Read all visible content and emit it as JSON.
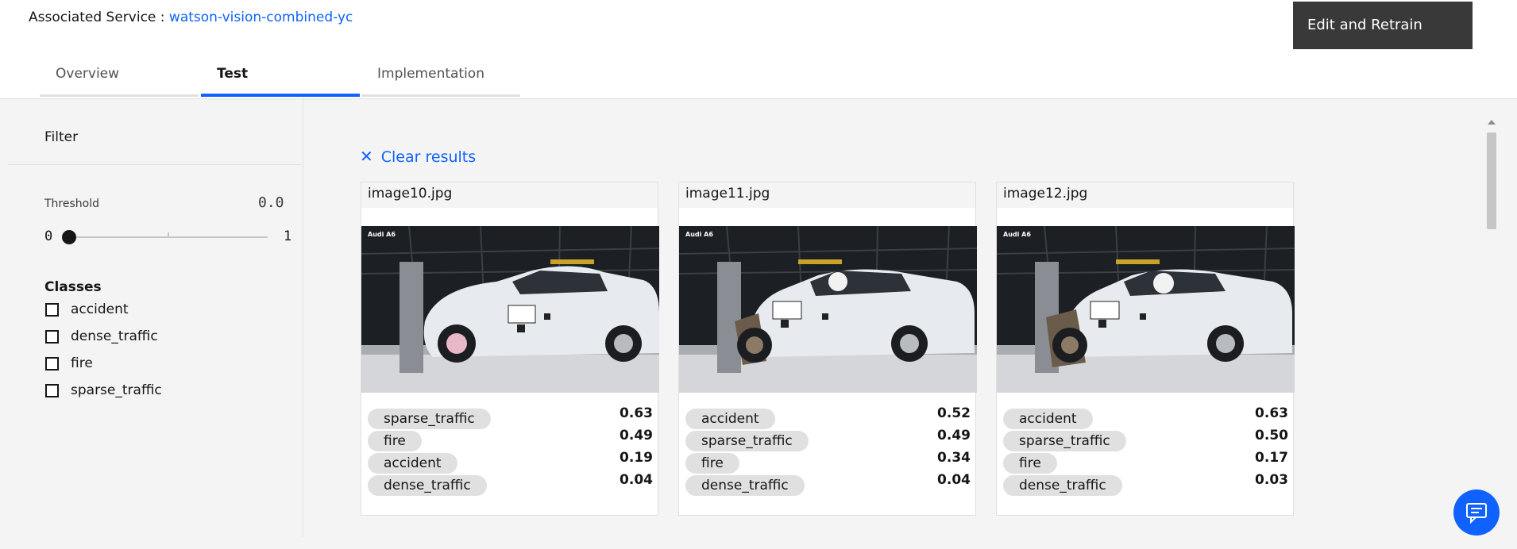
{
  "header": {
    "associated_label": "Associated Service :",
    "associated_link": "watson-vision-combined-yc",
    "edit_button": "Edit and Retrain"
  },
  "tabs": [
    {
      "label": "Overview",
      "active": false
    },
    {
      "label": "Test",
      "active": true
    },
    {
      "label": "Implementation",
      "active": false
    }
  ],
  "filter": {
    "title": "Filter",
    "threshold_label": "Threshold",
    "threshold_value": "0.0",
    "slider_min": "0",
    "slider_max": "1",
    "classes_title": "Classes",
    "classes": [
      "accident",
      "dense_traffic",
      "fire",
      "sparse_traffic"
    ]
  },
  "results": {
    "clear_label": "Clear results",
    "cards": [
      {
        "filename": "image10.jpg",
        "photo_label": "Audi A6",
        "scores": [
          {
            "class": "sparse_traffic",
            "score": "0.63"
          },
          {
            "class": "fire",
            "score": "0.49"
          },
          {
            "class": "accident",
            "score": "0.19"
          },
          {
            "class": "dense_traffic",
            "score": "0.04"
          }
        ]
      },
      {
        "filename": "image11.jpg",
        "photo_label": "Audi A6",
        "scores": [
          {
            "class": "accident",
            "score": "0.52"
          },
          {
            "class": "sparse_traffic",
            "score": "0.49"
          },
          {
            "class": "fire",
            "score": "0.34"
          },
          {
            "class": "dense_traffic",
            "score": "0.04"
          }
        ]
      },
      {
        "filename": "image12.jpg",
        "photo_label": "Audi A6",
        "scores": [
          {
            "class": "accident",
            "score": "0.63"
          },
          {
            "class": "sparse_traffic",
            "score": "0.50"
          },
          {
            "class": "fire",
            "score": "0.17"
          },
          {
            "class": "dense_traffic",
            "score": "0.03"
          }
        ]
      }
    ]
  },
  "icons": {
    "clear": "close-icon",
    "chat": "chat-icon",
    "scroll_up": "scroll-up-arrow-icon"
  },
  "colors": {
    "accent": "#0f62fe",
    "button_dark": "#393939",
    "tag_bg": "#e0e0e0",
    "panel_bg": "#f4f4f4"
  }
}
